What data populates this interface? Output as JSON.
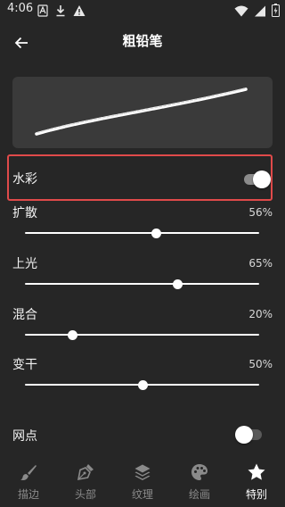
{
  "status_bar": {
    "time": "4:06"
  },
  "header": {
    "title": "粗铅笔"
  },
  "watercolor": {
    "label": "水彩",
    "enabled": true
  },
  "sliders": [
    {
      "label": "扩散",
      "value": "56%",
      "fraction": 0.56
    },
    {
      "label": "上光",
      "value": "65%",
      "fraction": 0.65
    },
    {
      "label": "混合",
      "value": "20%",
      "fraction": 0.2
    },
    {
      "label": "变干",
      "value": "50%",
      "fraction": 0.5
    }
  ],
  "halftone": {
    "label": "网点",
    "enabled": false
  },
  "bottom_nav": [
    {
      "label": "描边",
      "icon": "brush-icon"
    },
    {
      "label": "头部",
      "icon": "pen-nib-icon"
    },
    {
      "label": "纹理",
      "icon": "layers-icon"
    },
    {
      "label": "绘画",
      "icon": "palette-icon"
    },
    {
      "label": "特别",
      "icon": "star-icon",
      "active": true
    }
  ],
  "colors": {
    "background": "#262626",
    "preview_bg": "#3a3a3a",
    "highlight": "#e04a4a",
    "inactive": "#8a8a8a",
    "toggle_track_on": "#8c8c8c",
    "toggle_track_off": "#5a5a5a"
  }
}
